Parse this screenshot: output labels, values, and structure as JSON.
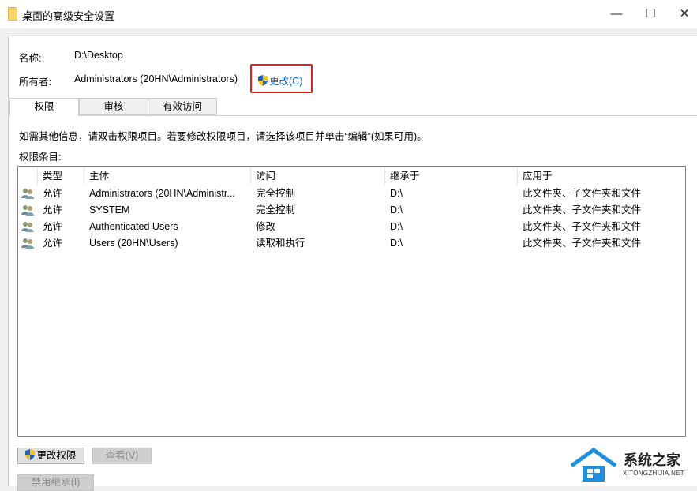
{
  "window": {
    "title": "桌面的高级安全设置",
    "minimize": "—",
    "maximize": "☐",
    "close": "✕"
  },
  "info": {
    "name_label": "名称:",
    "name_value": "D:\\Desktop",
    "owner_label": "所有者:",
    "owner_value": "Administrators (20HN\\Administrators)",
    "change_owner": "更改(C)"
  },
  "tabs": [
    {
      "label": "权限"
    },
    {
      "label": "审核"
    },
    {
      "label": "有效访问"
    }
  ],
  "hint": "如需其他信息，请双击权限项目。若要修改权限项目，请选择该项目并单击“编辑”(如果可用)。",
  "entries_label": "权限条目:",
  "table": {
    "columns": [
      "类型",
      "主体",
      "访问",
      "继承于",
      "应用于"
    ],
    "rows": [
      [
        "允许",
        "Administrators (20HN\\Administr...",
        "完全控制",
        "D:\\",
        "此文件夹、子文件夹和文件"
      ],
      [
        "允许",
        "SYSTEM",
        "完全控制",
        "D:\\",
        "此文件夹、子文件夹和文件"
      ],
      [
        "允许",
        "Authenticated Users",
        "修改",
        "D:\\",
        "此文件夹、子文件夹和文件"
      ],
      [
        "允许",
        "Users (20HN\\Users)",
        "读取和执行",
        "D:\\",
        "此文件夹、子文件夹和文件"
      ]
    ]
  },
  "buttons": {
    "change_permissions": "更改权限",
    "view": "查看(V)",
    "disable_inheritance": "禁用继承(I)"
  },
  "watermark": {
    "name": "系统之家",
    "url": "XITONGZHIJIA.NET"
  }
}
